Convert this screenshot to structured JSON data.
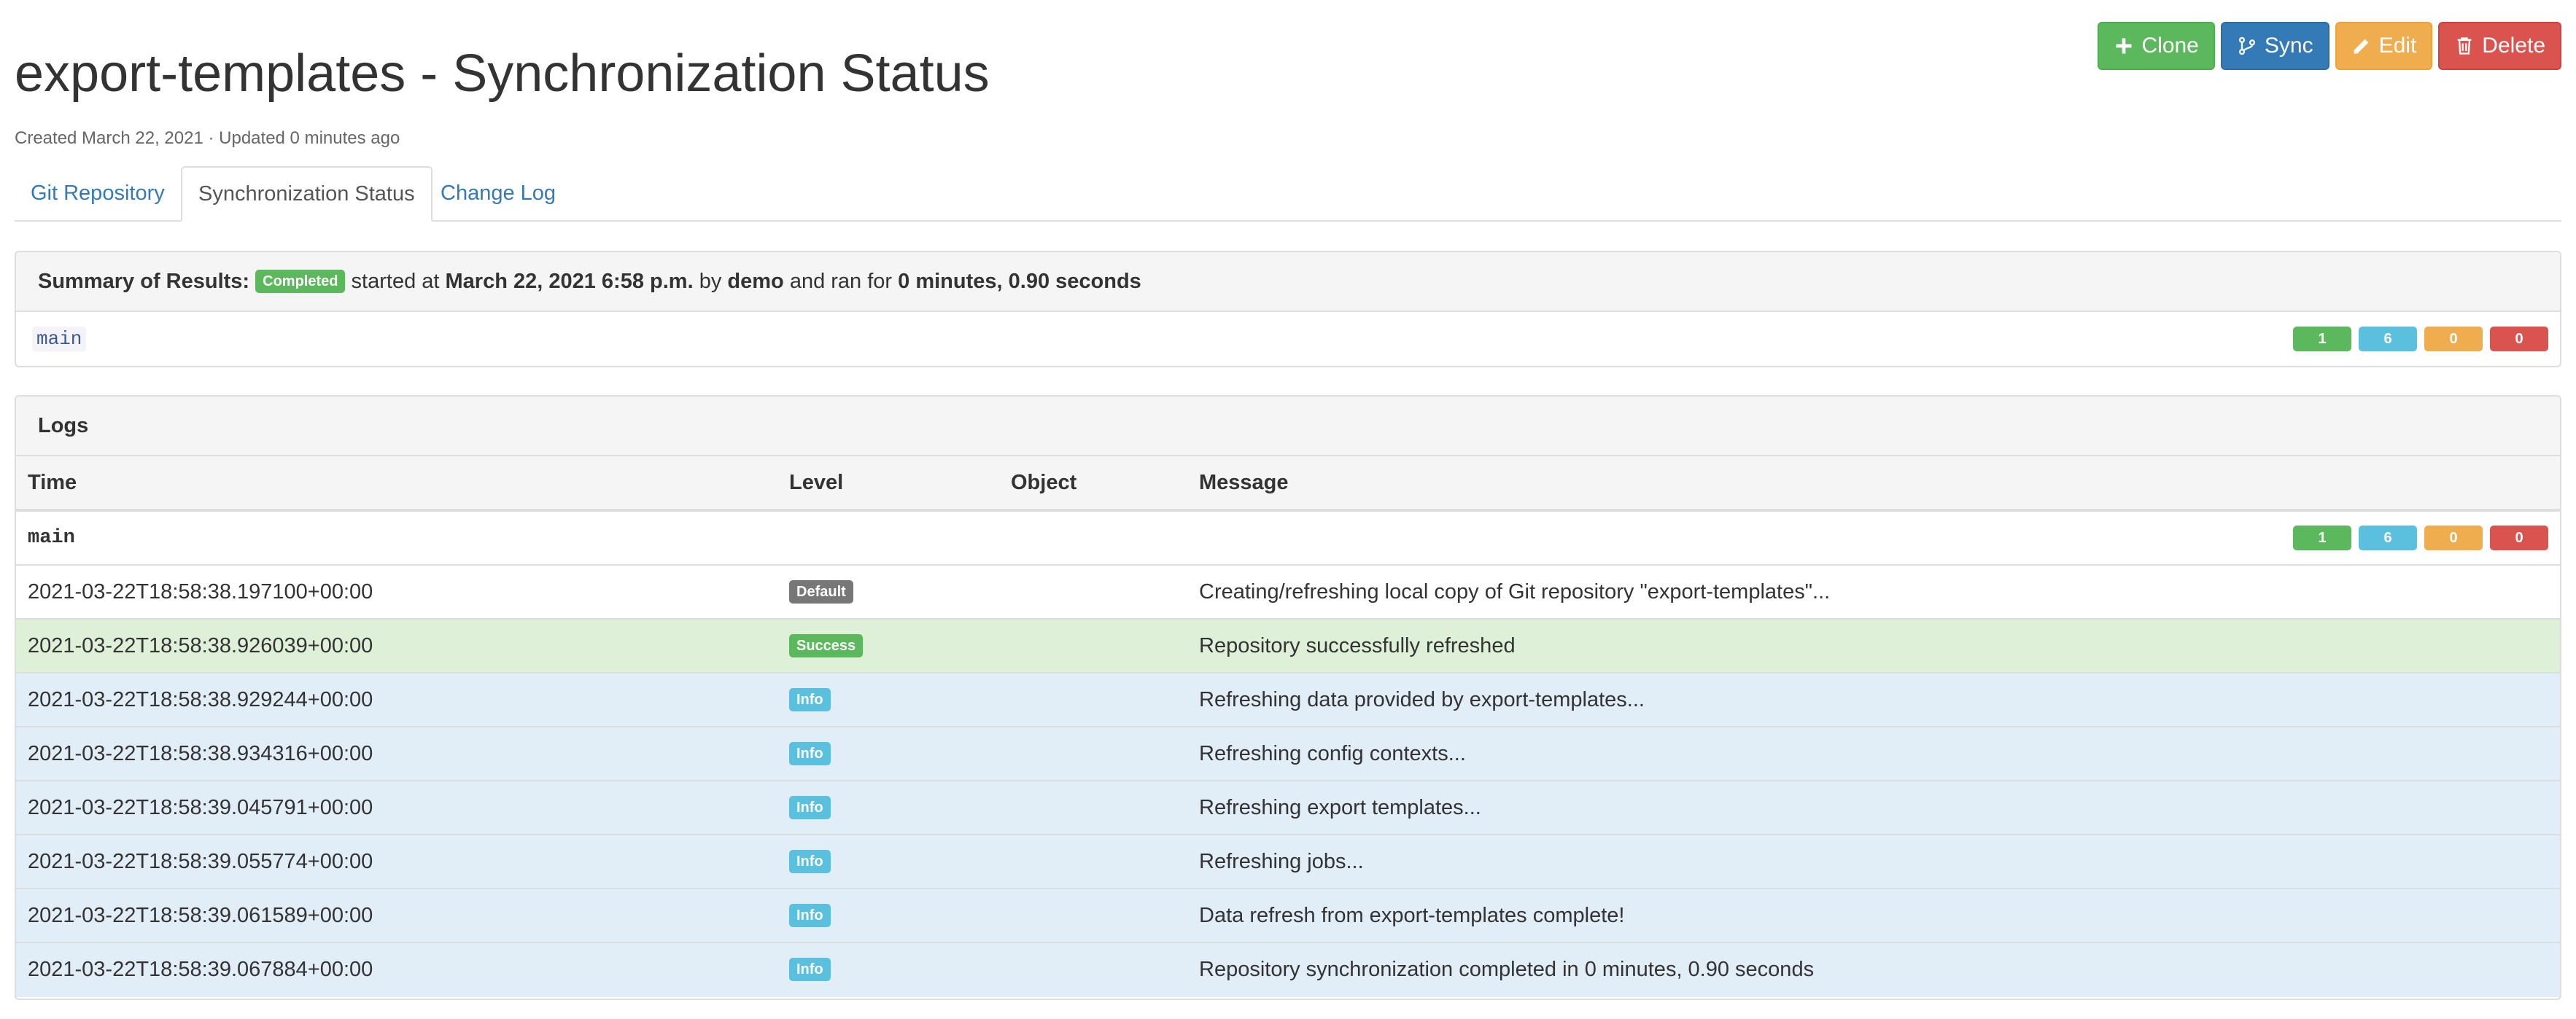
{
  "header": {
    "title": "export-templates - Synchronization Status",
    "subtitle": "Created March 22, 2021 · Updated 0 minutes ago"
  },
  "actions": {
    "clone": "Clone",
    "sync": "Sync",
    "edit": "Edit",
    "delete": "Delete"
  },
  "tabs": [
    {
      "label": "Git Repository",
      "active": false
    },
    {
      "label": "Synchronization Status",
      "active": true
    },
    {
      "label": "Change Log",
      "active": false
    }
  ],
  "summary": {
    "prefix": "Summary of Results:",
    "status": "Completed",
    "started_text": "started at",
    "started_at": "March 22, 2021 6:58 p.m.",
    "by_text": "by",
    "user": "demo",
    "ran_text": "and ran for",
    "duration": "0 minutes, 0.90 seconds",
    "branch": "main",
    "counts": {
      "success": "1",
      "info": "6",
      "warning": "0",
      "failure": "0"
    }
  },
  "logs": {
    "title": "Logs",
    "columns": {
      "time": "Time",
      "level": "Level",
      "object": "Object",
      "message": "Message"
    },
    "group": {
      "name": "main",
      "counts": {
        "success": "1",
        "info": "6",
        "warning": "0",
        "failure": "0"
      }
    },
    "rows": [
      {
        "time": "2021-03-22T18:58:38.197100+00:00",
        "level": "Default",
        "message": "Creating/refreshing local copy of Git repository \"export-templates\"..."
      },
      {
        "time": "2021-03-22T18:58:38.926039+00:00",
        "level": "Success",
        "message": "Repository successfully refreshed"
      },
      {
        "time": "2021-03-22T18:58:38.929244+00:00",
        "level": "Info",
        "message": "Refreshing data provided by export-templates..."
      },
      {
        "time": "2021-03-22T18:58:38.934316+00:00",
        "level": "Info",
        "message": "Refreshing config contexts..."
      },
      {
        "time": "2021-03-22T18:58:39.045791+00:00",
        "level": "Info",
        "message": "Refreshing export templates..."
      },
      {
        "time": "2021-03-22T18:58:39.055774+00:00",
        "level": "Info",
        "message": "Refreshing jobs..."
      },
      {
        "time": "2021-03-22T18:58:39.061589+00:00",
        "level": "Info",
        "message": "Data refresh from export-templates complete!"
      },
      {
        "time": "2021-03-22T18:58:39.067884+00:00",
        "level": "Info",
        "message": "Repository synchronization completed in 0 minutes, 0.90 seconds"
      }
    ]
  },
  "colors": {
    "success": "#5cb85c",
    "primary": "#337ab7",
    "warning": "#f0ad4e",
    "danger": "#d9534f",
    "info": "#5bc0de",
    "default": "#777777"
  }
}
